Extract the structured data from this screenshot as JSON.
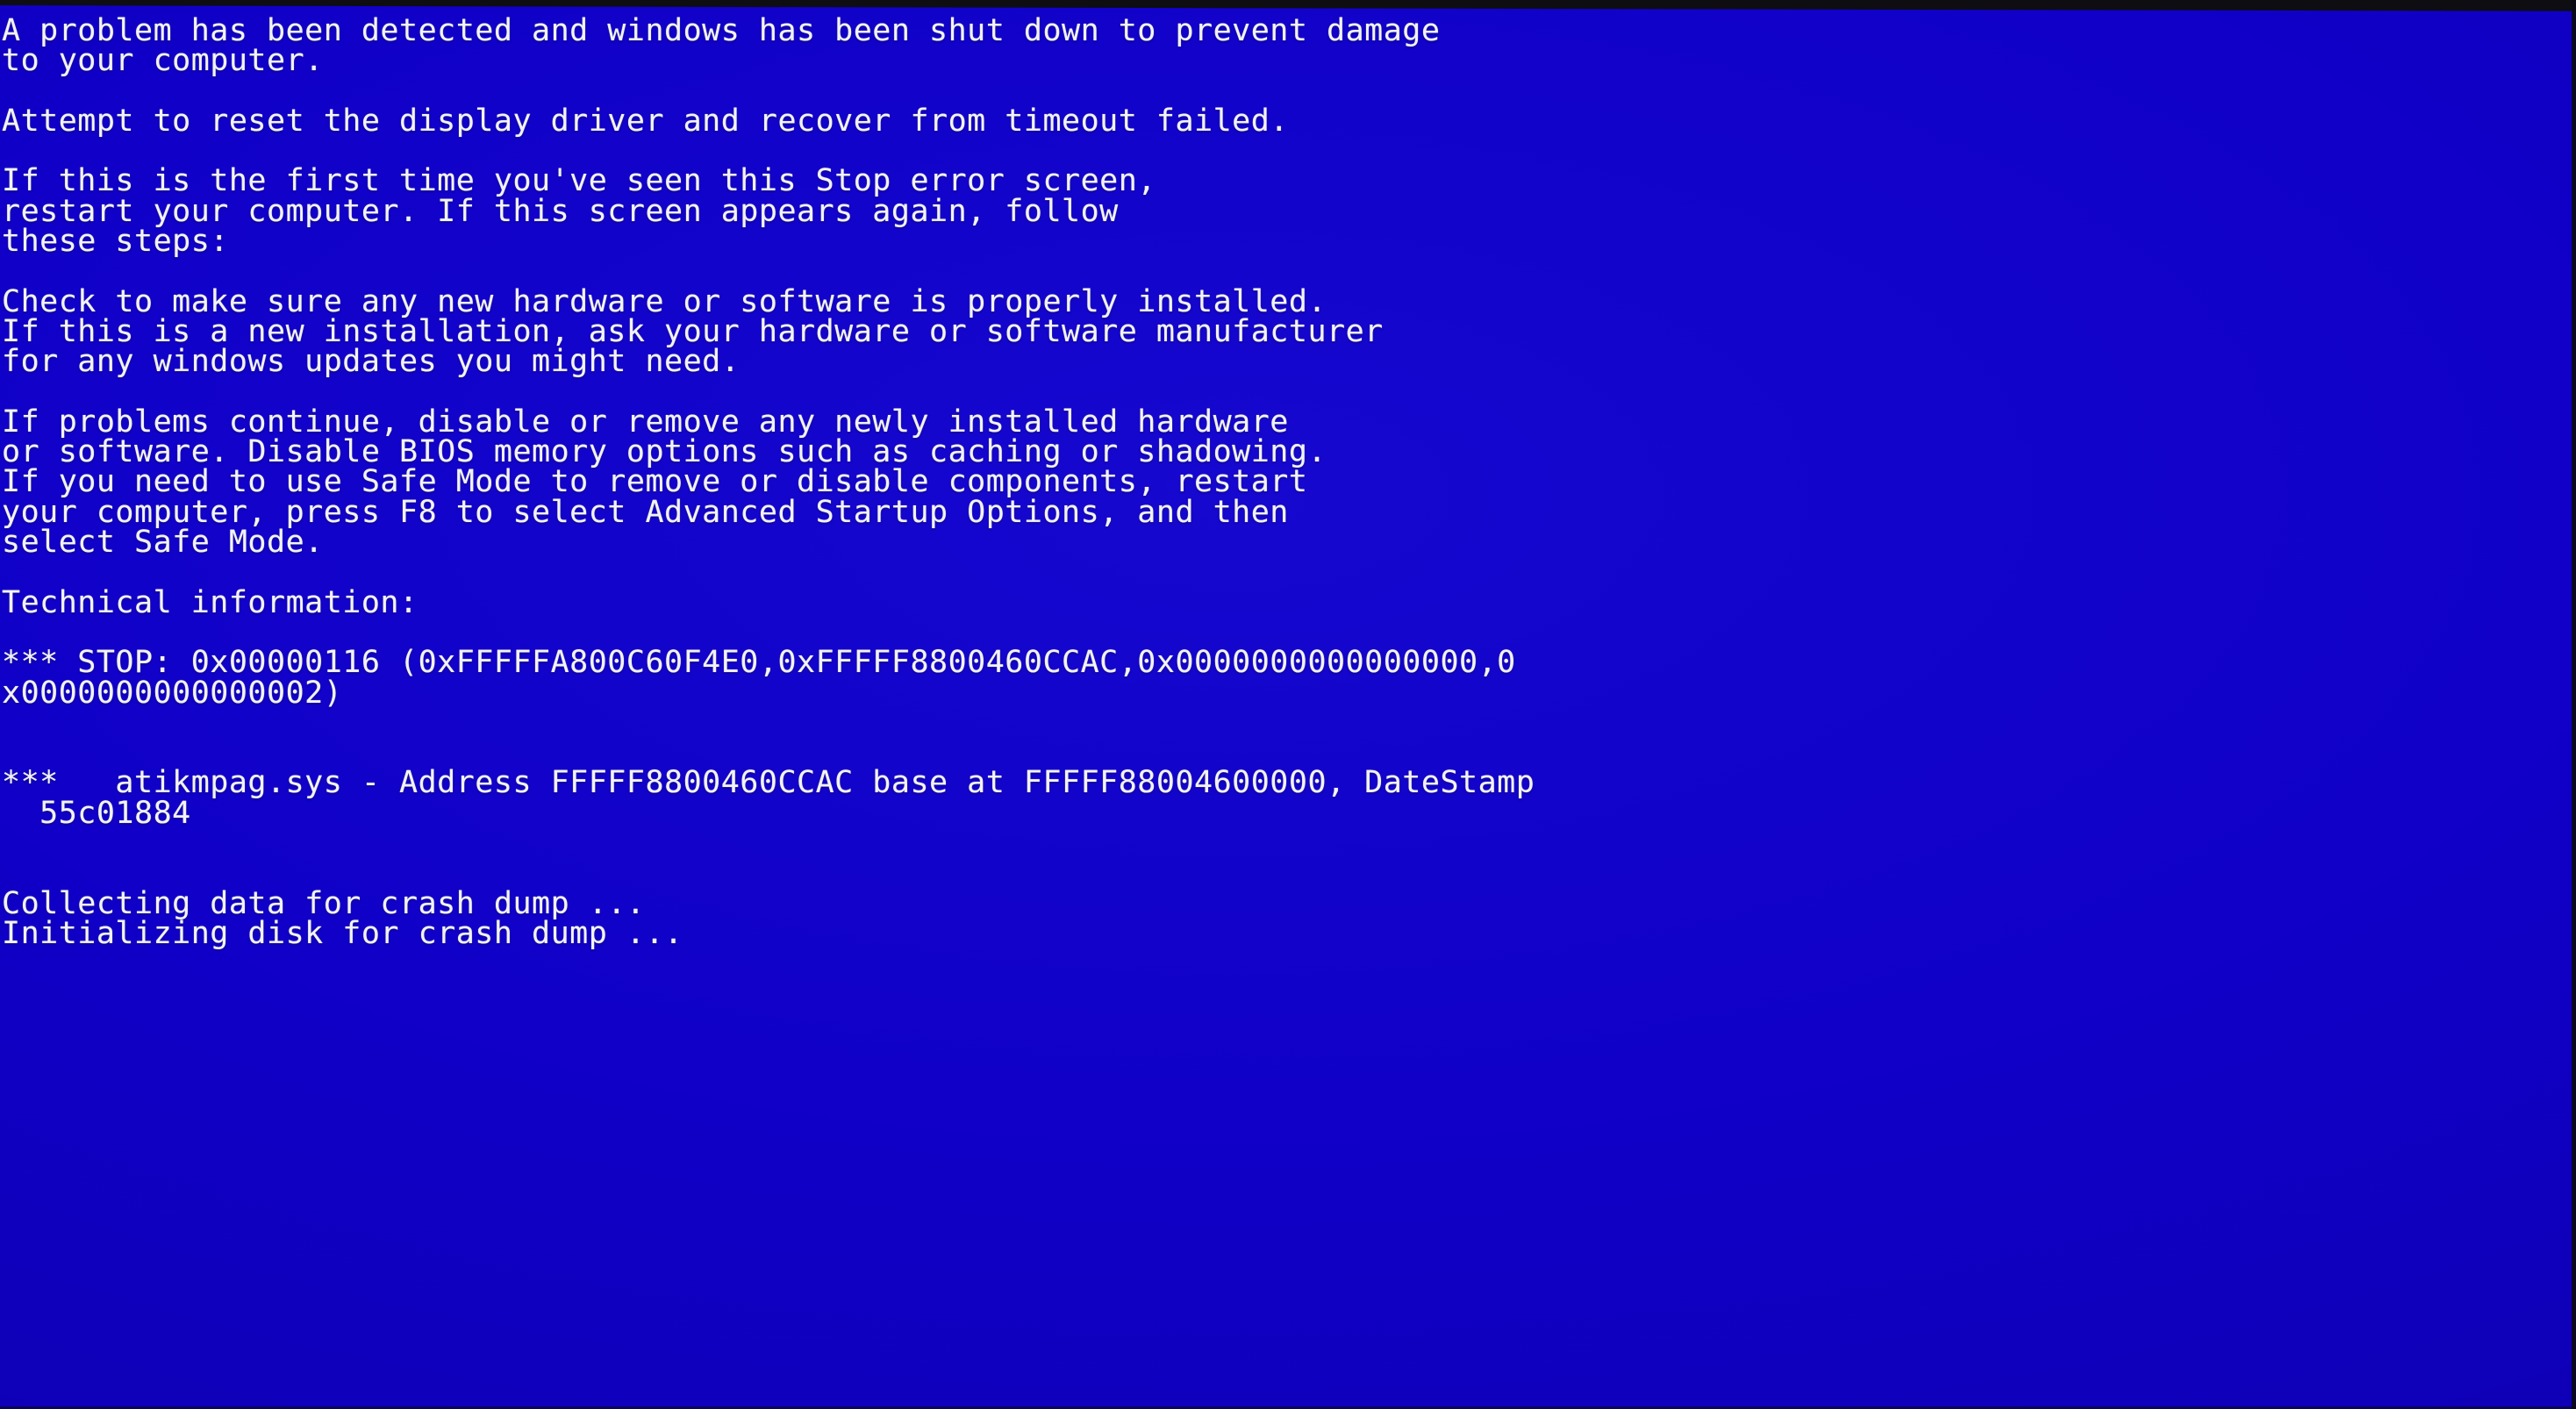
{
  "screen": {
    "kind": "windows-blue-screen-of-death",
    "background_color": "#1000c8",
    "text_color": "#f2f2f8",
    "bezel_color": "#0d0d12"
  },
  "bsod": {
    "intro": [
      "A problem has been detected and windows has been shut down to prevent damage",
      "to your computer."
    ],
    "cause": [
      "Attempt to reset the display driver and recover from timeout failed."
    ],
    "first_time": [
      "If this is the first time you've seen this Stop error screen,",
      "restart your computer. If this screen appears again, follow",
      "these steps:"
    ],
    "hardware_check": [
      "Check to make sure any new hardware or software is properly installed.",
      "If this is a new installation, ask your hardware or software manufacturer",
      "for any windows updates you might need."
    ],
    "troubleshoot": [
      "If problems continue, disable or remove any newly installed hardware",
      "or software. Disable BIOS memory options such as caching or shadowing.",
      "If you need to use Safe Mode to remove or disable components, restart",
      "your computer, press F8 to select Advanced Startup Options, and then",
      "select Safe Mode."
    ],
    "technical_heading": "Technical information:",
    "stop_lines": [
      "*** STOP: 0x00000116 (0xFFFFFA800C60F4E0,0xFFFFF8800460CCAC,0x0000000000000000,0",
      "x0000000000000002)"
    ],
    "driver_lines": [
      "***   atikmpag.sys - Address FFFFF8800460CCAC base at FFFFF88004600000, DateStamp",
      "  55c01884"
    ],
    "dump_lines": [
      "Collecting data for crash dump ...",
      "Initializing disk for crash dump ..."
    ],
    "stop_code": "0x00000116",
    "parameters": [
      "0xFFFFFA800C60F4E0",
      "0xFFFFF8800460CCAC",
      "0x0000000000000000",
      "0x0000000000000002"
    ],
    "driver_name": "atikmpag.sys",
    "driver_address": "FFFFF8800460CCAC",
    "driver_base": "FFFFF88004600000",
    "driver_datestamp": "55c01884"
  }
}
